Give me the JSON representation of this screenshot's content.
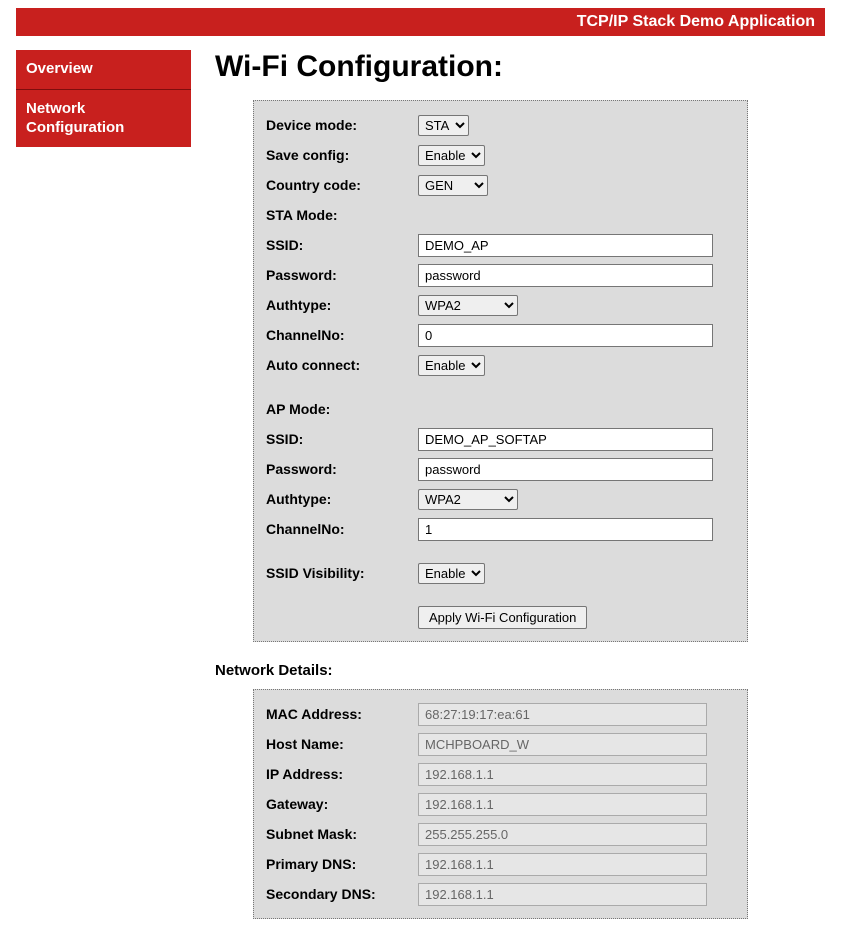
{
  "header": {
    "title": "TCP/IP Stack Demo Application"
  },
  "sidebar": {
    "items": [
      {
        "label": "Overview"
      },
      {
        "label": "Network Configuration"
      }
    ]
  },
  "page": {
    "title": "Wi-Fi Configuration:"
  },
  "wifi": {
    "device_mode_label": "Device mode:",
    "device_mode_value": "STA",
    "device_mode_options": [
      "STA"
    ],
    "save_config_label": "Save config:",
    "save_config_value": "Enable",
    "save_config_options": [
      "Enable"
    ],
    "country_code_label": "Country code:",
    "country_code_value": "GEN",
    "country_code_options": [
      "GEN"
    ],
    "sta_section_label": "STA Mode:",
    "sta_ssid_label": "SSID:",
    "sta_ssid_value": "DEMO_AP",
    "sta_password_label": "Password:",
    "sta_password_value": "password",
    "sta_authtype_label": "Authtype:",
    "sta_authtype_value": "WPA2",
    "sta_authtype_options": [
      "WPA2"
    ],
    "sta_channelno_label": "ChannelNo:",
    "sta_channelno_value": "0",
    "sta_autoconnect_label": "Auto connect:",
    "sta_autoconnect_value": "Enable",
    "sta_autoconnect_options": [
      "Enable"
    ],
    "ap_section_label": "AP Mode:",
    "ap_ssid_label": "SSID:",
    "ap_ssid_value": "DEMO_AP_SOFTAP",
    "ap_password_label": "Password:",
    "ap_password_value": "password",
    "ap_authtype_label": "Authtype:",
    "ap_authtype_value": "WPA2",
    "ap_authtype_options": [
      "WPA2"
    ],
    "ap_channelno_label": "ChannelNo:",
    "ap_channelno_value": "1",
    "ssid_visibility_label": "SSID Visibility:",
    "ssid_visibility_value": "Enable",
    "ssid_visibility_options": [
      "Enable"
    ],
    "apply_button_label": "Apply Wi-Fi Configuration"
  },
  "network_details": {
    "heading": "Network Details:",
    "mac_address_label": "MAC Address:",
    "mac_address_value": "68:27:19:17:ea:61",
    "host_name_label": "Host Name:",
    "host_name_value": "MCHPBOARD_W",
    "ip_address_label": "IP Address:",
    "ip_address_value": "192.168.1.1",
    "gateway_label": "Gateway:",
    "gateway_value": "192.168.1.1",
    "subnet_mask_label": "Subnet Mask:",
    "subnet_mask_value": "255.255.255.0",
    "primary_dns_label": "Primary DNS:",
    "primary_dns_value": "192.168.1.1",
    "secondary_dns_label": "Secondary DNS:",
    "secondary_dns_value": "192.168.1.1"
  }
}
